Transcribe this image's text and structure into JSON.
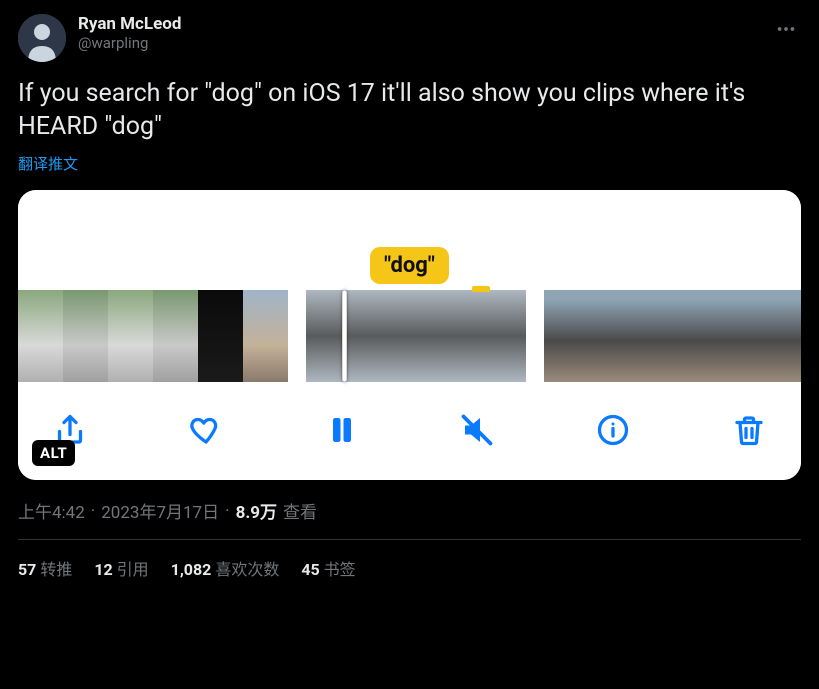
{
  "author": {
    "display_name": "Ryan McLeod",
    "handle": "@warpling"
  },
  "body_text": "If you search for \"dog\" on iOS 17 it'll also show you clips where it's HEARD \"dog\"",
  "translate_label": "翻译推文",
  "media": {
    "caption_tag": "\"dog\"",
    "alt_badge": "ALT"
  },
  "meta": {
    "time": "上午4:42",
    "dot1": "·",
    "date": "2023年7月17日",
    "dot2": "·",
    "views_count": "8.9万",
    "views_label": "查看"
  },
  "stats": {
    "retweets_n": "57",
    "retweets_l": "转推",
    "quotes_n": "12",
    "quotes_l": "引用",
    "likes_n": "1,082",
    "likes_l": "喜欢次数",
    "bookmarks_n": "45",
    "bookmarks_l": "书签"
  }
}
